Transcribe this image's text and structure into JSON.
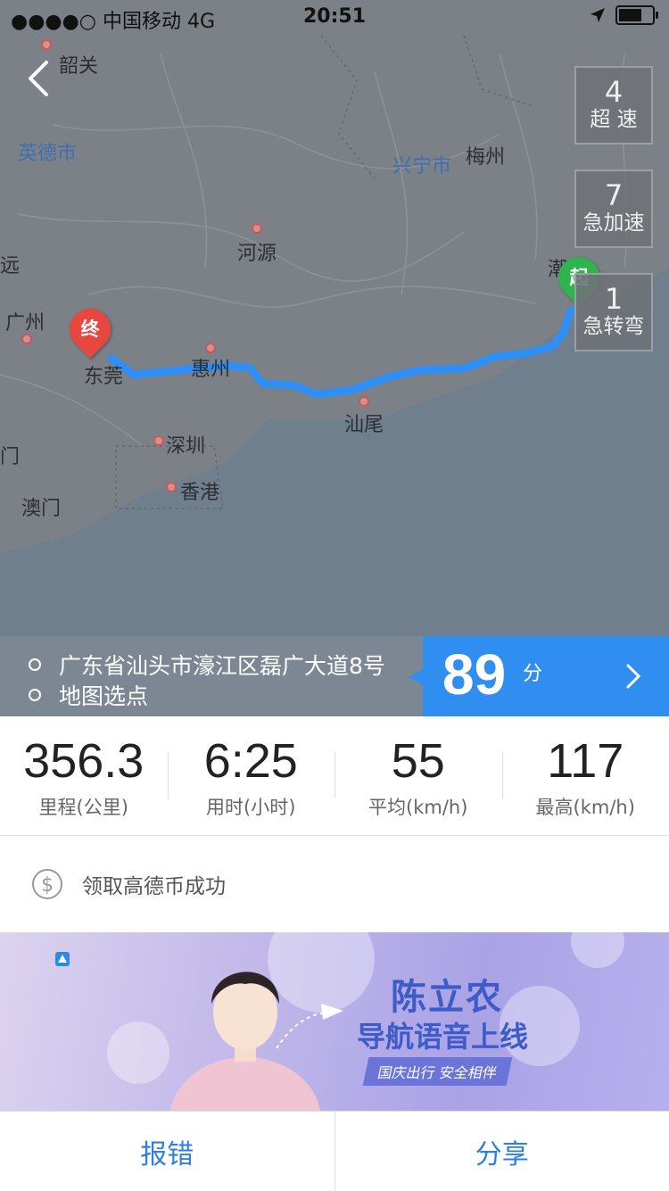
{
  "status_bar": {
    "carrier": "●●●●○ 中国移动  4G",
    "time": "20:51"
  },
  "map": {
    "cities": [
      {
        "name": "韶关",
        "blue": false
      },
      {
        "name": "英德市",
        "blue": true
      },
      {
        "name": "兴宁市",
        "blue": true
      },
      {
        "name": "梅州",
        "blue": false
      },
      {
        "name": "河源",
        "blue": false
      },
      {
        "name": "潮",
        "blue": false
      },
      {
        "name": "广州",
        "blue": false
      },
      {
        "name": "东莞",
        "blue": false
      },
      {
        "name": "惠州",
        "blue": false
      },
      {
        "name": "汕尾",
        "blue": false
      },
      {
        "name": "深圳",
        "blue": false
      },
      {
        "name": "香港",
        "blue": false
      },
      {
        "name": "澳门",
        "blue": false
      },
      {
        "name": "远",
        "blue": false
      },
      {
        "name": "门",
        "blue": false
      }
    ],
    "start_pin": "起",
    "end_pin": "终",
    "route_color": "#2f8ff5"
  },
  "events": [
    {
      "count": "4",
      "label": "超 速"
    },
    {
      "count": "7",
      "label": "急加速"
    },
    {
      "count": "1",
      "label": "急转弯"
    }
  ],
  "route": {
    "origin": "广东省汕头市濠江区磊广大道8号",
    "destination": "地图选点",
    "duration_value": "89",
    "duration_unit": "分"
  },
  "stats": [
    {
      "value": "356.3",
      "caption": "里程(公里)"
    },
    {
      "value": "6:25",
      "caption": "用时(小时)"
    },
    {
      "value": "55",
      "caption": "平均(km/h)"
    },
    {
      "value": "117",
      "caption": "最高(km/h)"
    }
  ],
  "coin": {
    "text": "领取高德币成功"
  },
  "banner": {
    "title": "陈立农",
    "subtitle": "导航语音上线",
    "tag": "国庆出行 安全相伴"
  },
  "bottom": {
    "report_label": "报错",
    "share_label": "分享"
  }
}
